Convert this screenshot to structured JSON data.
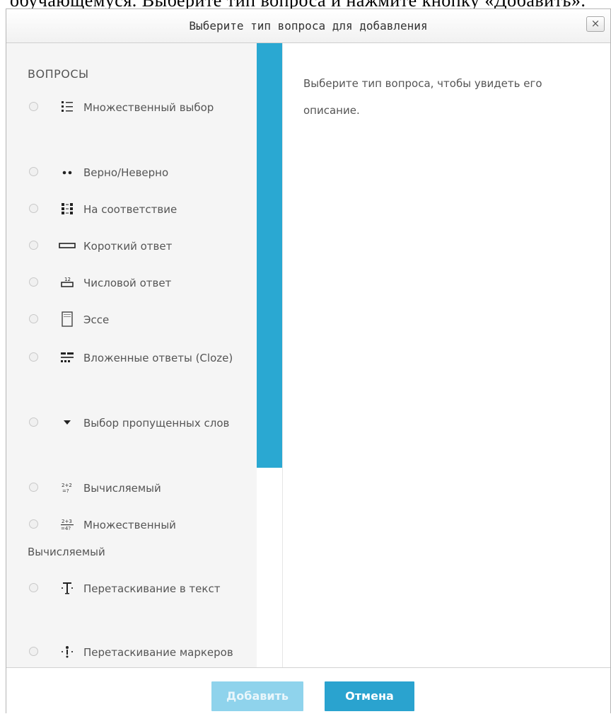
{
  "document": {
    "text_above": "обучающемуся. Выберите тип вопроса и нажмите кнопку «Добавить»."
  },
  "dialog": {
    "title": "Выберите тип вопроса для добавления",
    "close_label": "×"
  },
  "sidebar": {
    "heading": "ВОПРОСЫ",
    "items": [
      {
        "label": "Множественный выбор",
        "icon": "multichoice-icon"
      },
      {
        "label": "Верно/Неверно",
        "icon": "truefalse-icon"
      },
      {
        "label": "На соответствие",
        "icon": "match-icon"
      },
      {
        "label": "Короткий ответ",
        "icon": "shortanswer-icon"
      },
      {
        "label": "Числовой ответ",
        "icon": "numerical-icon"
      },
      {
        "label": "Эссе",
        "icon": "essay-icon"
      },
      {
        "label": "Вложенные ответы (Cloze)",
        "icon": "cloze-icon"
      },
      {
        "label": "Выбор пропущенных слов",
        "icon": "gapselect-icon"
      },
      {
        "label": "Вычисляемый",
        "icon": "calculated-icon"
      },
      {
        "label": "Множественный Вычисляемый",
        "icon": "calculatedmulti-icon"
      },
      {
        "label": "Перетаскивание в текст",
        "icon": "ddwtos-icon"
      },
      {
        "label": "Перетаскивание маркеров",
        "icon": "ddmarker-icon"
      }
    ]
  },
  "description": {
    "text": "Выберите тип вопроса, чтобы увидеть его описание."
  },
  "footer": {
    "add_label": "Добавить",
    "cancel_label": "Отмена"
  },
  "colors": {
    "accent": "#2aa8d2",
    "add_disabled": "#8fd3ec",
    "panel_bg": "#f5f5f5"
  }
}
